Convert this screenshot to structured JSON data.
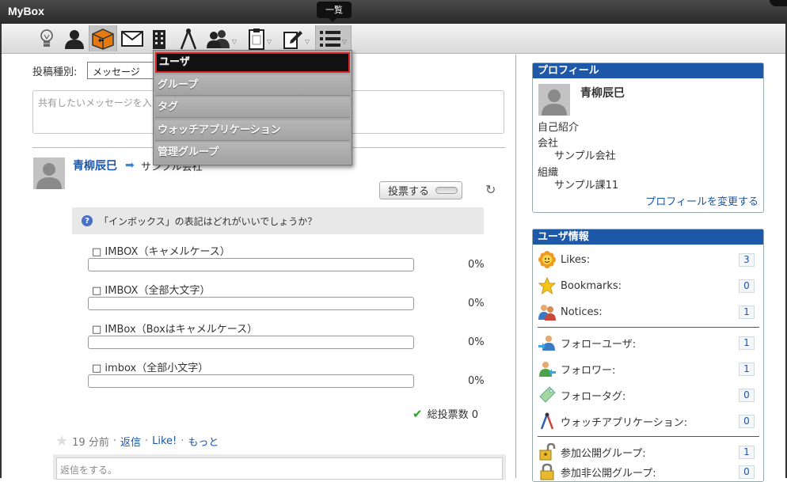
{
  "window": {
    "title": "MyBox"
  },
  "toolbar": {
    "tooltip": "一覧",
    "icons": [
      "lightbulb-icon",
      "user-icon",
      "box-icon",
      "mail-icon",
      "building-icon",
      "compass-icon",
      "group-icon",
      "clipboard-icon",
      "edit-icon",
      "list-icon"
    ]
  },
  "list_menu": {
    "items": [
      "ユーザ",
      "グループ",
      "タグ",
      "ウォッチアプリケーション",
      "管理グループ"
    ],
    "selected": 0
  },
  "composer": {
    "type_label": "投稿種別:",
    "type_value": "メッセージ",
    "message_placeholder": "共有したいメッセージを入力"
  },
  "post": {
    "author": "青柳辰巳",
    "target": "サンプル会社",
    "vote_button": "投票する",
    "question": "「インボックス」の表記はどれがいいでしょうか？",
    "options": [
      {
        "label": "□ IMBOX（キャメルケース）",
        "percent": "0%"
      },
      {
        "label": "□ IMBOX（全部大文字）",
        "percent": "0%"
      },
      {
        "label": "□ IMBox（Boxはキャメルケース）",
        "percent": "0%"
      },
      {
        "label": "□ imbox（全部小文字）",
        "percent": "0%"
      }
    ],
    "total": "総投票数 0",
    "time": "19 分前",
    "actions": {
      "reply": "返信",
      "like": "Like!",
      "more": "もっと"
    },
    "reply_placeholder": "返信をする。"
  },
  "profile": {
    "header": "プロフィール",
    "name": "青柳辰巳",
    "intro_label": "自己紹介",
    "company_label": "会社",
    "company_value": "サンプル会社",
    "org_label": "組織",
    "org_value": "サンプル課11",
    "edit_link": "プロフィールを変更する"
  },
  "user_info": {
    "header": "ユーザ情報",
    "rows": [
      {
        "label": "Likes:",
        "count": "3",
        "icon": "likes-flower-icon"
      },
      {
        "label": "Bookmarks:",
        "count": "0",
        "icon": "star-icon"
      },
      {
        "label": "Notices:",
        "count": "1",
        "icon": "people-icon"
      },
      {
        "label": "フォローユーザ:",
        "count": "1",
        "icon": "follow-user-icon"
      },
      {
        "label": "フォロワー:",
        "count": "1",
        "icon": "follower-icon"
      },
      {
        "label": "フォロータグ:",
        "count": "0",
        "icon": "tag-icon"
      },
      {
        "label": "ウォッチアプリケーション:",
        "count": "0",
        "icon": "compass-icon"
      },
      {
        "label": "参加公開グループ:",
        "count": "1",
        "icon": "unlock-icon"
      },
      {
        "label": "参加非公開グループ:",
        "count": "0",
        "icon": "lock-icon"
      }
    ]
  }
}
